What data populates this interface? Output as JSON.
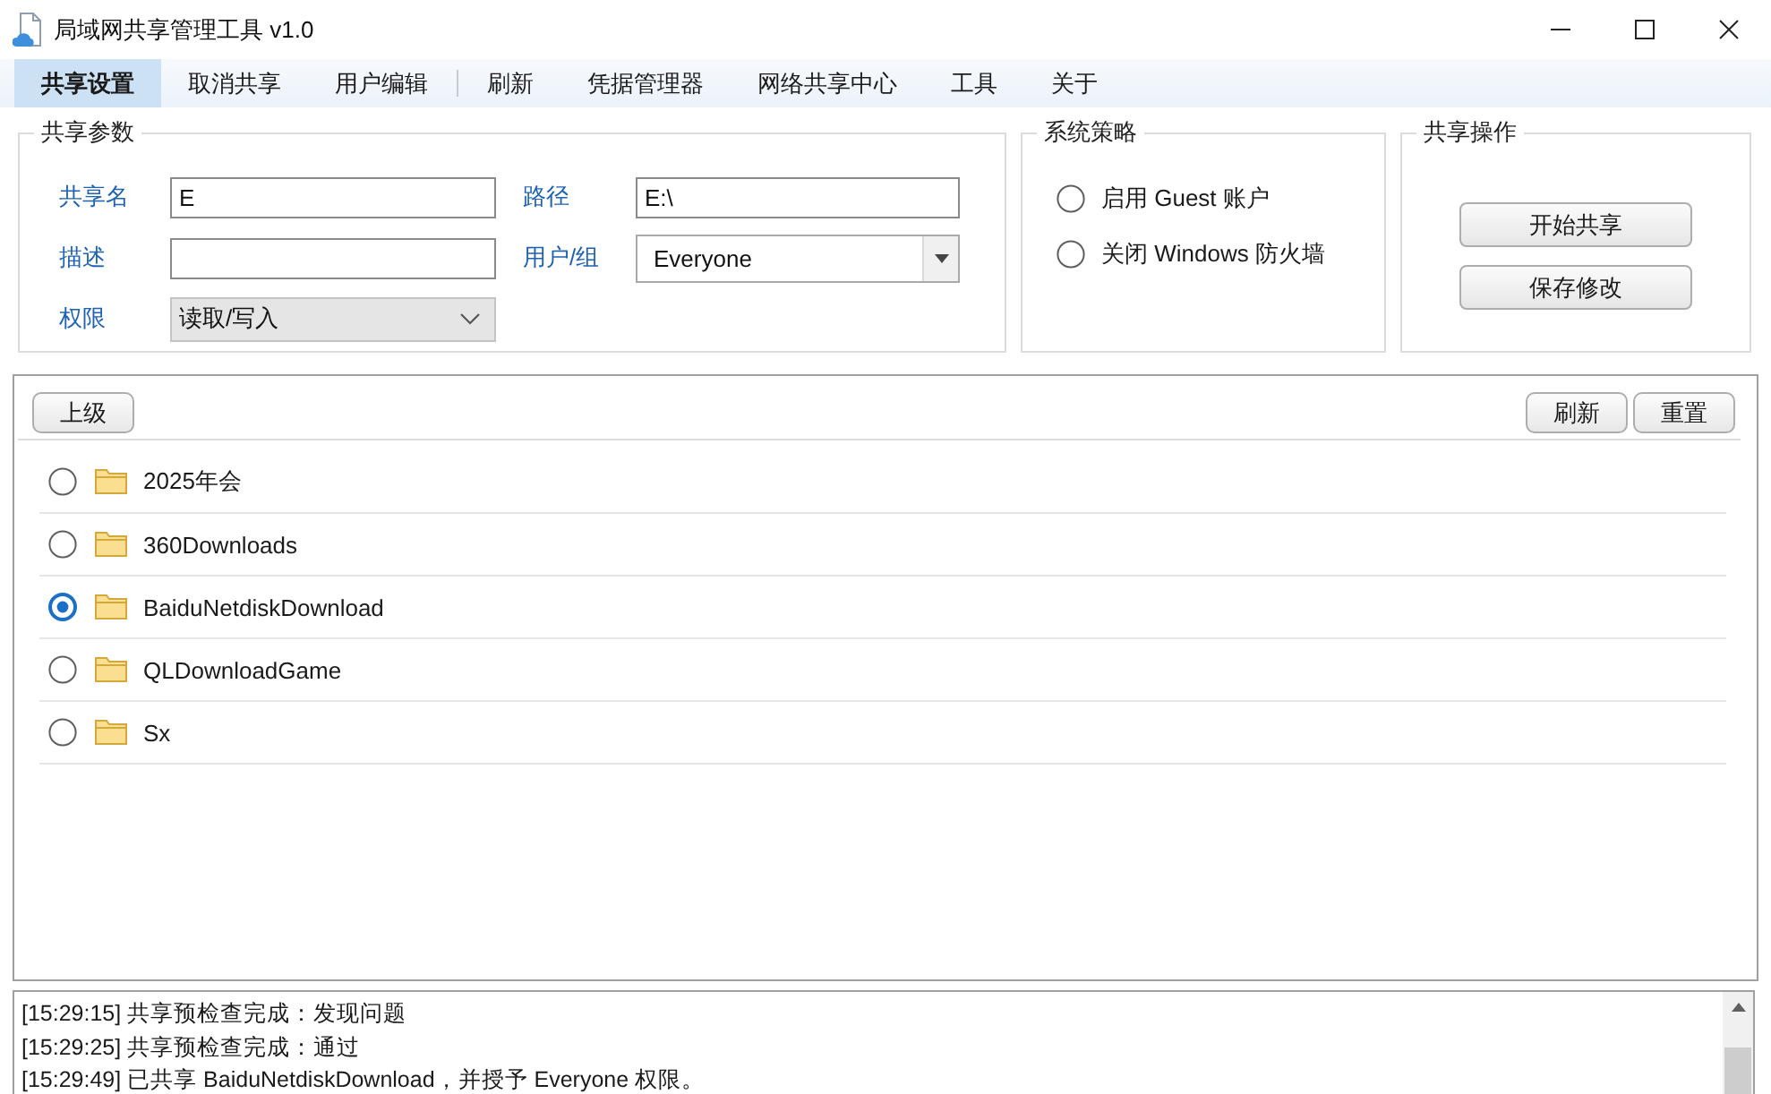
{
  "window": {
    "title": "局域网共享管理工具 v1.0"
  },
  "menu": {
    "groups": [
      {
        "items": [
          {
            "label": "共享设置",
            "selected": true
          },
          {
            "label": "取消共享",
            "selected": false
          },
          {
            "label": "用户编辑",
            "selected": false
          }
        ]
      },
      {
        "items": [
          {
            "label": "刷新",
            "selected": false
          },
          {
            "label": "凭据管理器",
            "selected": false
          },
          {
            "label": "网络共享中心",
            "selected": false
          },
          {
            "label": "工具",
            "selected": false
          },
          {
            "label": "关于",
            "selected": false
          }
        ]
      }
    ]
  },
  "share_params": {
    "title": "共享参数",
    "fields": [
      {
        "label": "共享名",
        "kind": "text",
        "value": "E"
      },
      {
        "label": "路径",
        "kind": "text",
        "value": "E:\\"
      },
      {
        "label": "描述",
        "kind": "text"
      },
      {
        "label": "用户/组",
        "kind": "combo",
        "value": "Everyone"
      },
      {
        "label": "权限",
        "kind": "select",
        "value": "读取/写入"
      }
    ]
  },
  "system_policy": {
    "title": "系统策略",
    "options": [
      {
        "label": "启用 Guest 账户",
        "selected": false
      },
      {
        "label": "关闭 Windows 防火墙",
        "selected": false
      }
    ]
  },
  "share_actions": {
    "title": "共享操作",
    "buttons": [
      "开始共享",
      "保存修改"
    ]
  },
  "folder_browser": {
    "toolbar_left": [
      "上级"
    ],
    "toolbar_right": [
      "刷新",
      "重置"
    ],
    "folders": [
      {
        "name": "2025年会",
        "selected": false
      },
      {
        "name": "360Downloads",
        "selected": false
      },
      {
        "name": "BaiduNetdiskDownload",
        "selected": true
      },
      {
        "name": "QLDownloadGame",
        "selected": false
      },
      {
        "name": "Sx",
        "selected": false
      }
    ]
  },
  "log": {
    "lines": [
      "[15:29:15] 共享预检查完成：发现问题",
      "[15:29:25] 共享预检查完成：通过",
      "[15:29:49] 已共享 BaiduNetdiskDownload，并授予 Everyone 权限。"
    ]
  }
}
